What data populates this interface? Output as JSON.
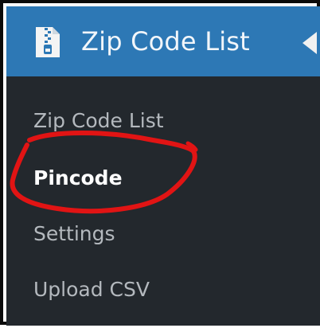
{
  "menu": {
    "header": {
      "title": "Zip Code List",
      "icon": "zip-file-icon",
      "collapse_icon": "collapse-arrow-icon"
    },
    "items": [
      {
        "label": "Zip Code List",
        "current": false
      },
      {
        "label": "Pincode",
        "current": true
      },
      {
        "label": "Settings",
        "current": false
      },
      {
        "label": "Upload CSV",
        "current": false
      }
    ]
  },
  "colors": {
    "menu_background": "#23282d",
    "header_background": "#2d78b5",
    "item_text": "#b4b9be",
    "current_item_text": "#ffffff",
    "annotation_circle": "#e11414"
  }
}
